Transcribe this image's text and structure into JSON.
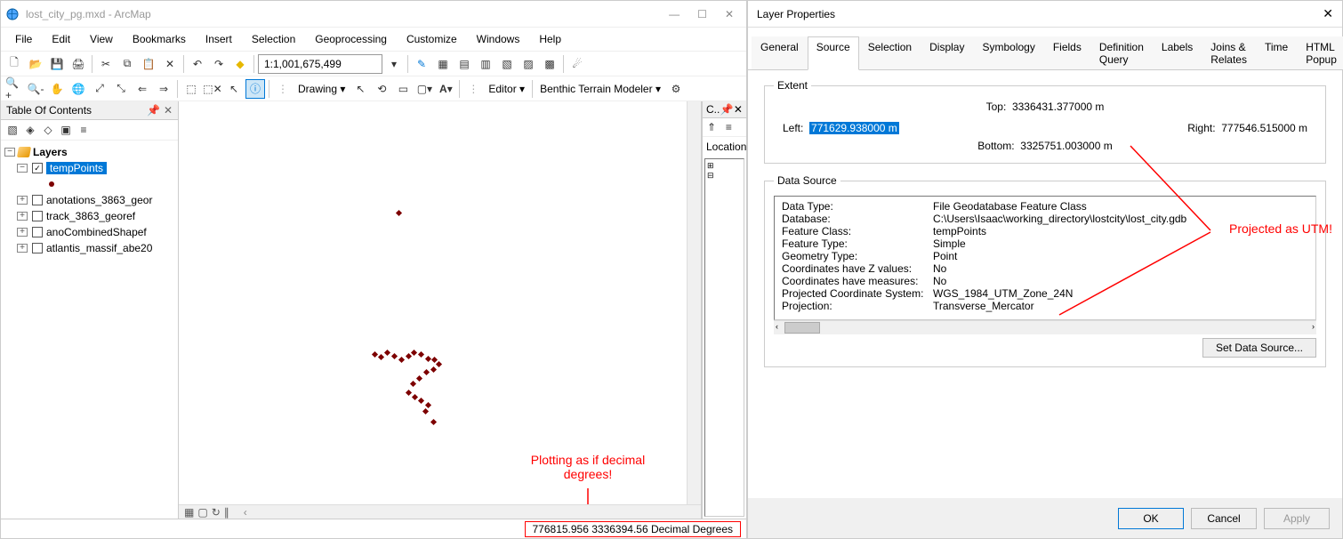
{
  "arcmap": {
    "title": "lost_city_pg.mxd - ArcMap",
    "window_controls": {
      "min": "—",
      "max": "☐",
      "close": "✕"
    },
    "menus": [
      "File",
      "Edit",
      "View",
      "Bookmarks",
      "Insert",
      "Selection",
      "Geoprocessing",
      "Customize",
      "Windows",
      "Help"
    ],
    "scale": "1:1,001,675,499",
    "drawing_label": "Drawing ▾",
    "editor_label": "Editor ▾",
    "btm_label": "Benthic Terrain Modeler ▾",
    "toc_title": "Table Of Contents",
    "toc": {
      "root": "Layers",
      "items": [
        {
          "name": "tempPoints",
          "checked": true,
          "selected": true
        },
        {
          "name": "anotations_3863_geor",
          "checked": false,
          "selected": false
        },
        {
          "name": "track_3863_georef",
          "checked": false,
          "selected": false
        },
        {
          "name": "anoCombinedShapef",
          "checked": false,
          "selected": false
        },
        {
          "name": "atlantis_massif_abe20",
          "checked": false,
          "selected": false
        }
      ]
    },
    "catalog_tab": "C..",
    "location_label": "Location:",
    "status_coord": "776815.956  3336394.56 Decimal Degrees",
    "annotation1": "Plotting as if decimal degrees!"
  },
  "dialog": {
    "title": "Layer Properties",
    "close": "✕",
    "tabs": [
      "General",
      "Source",
      "Selection",
      "Display",
      "Symbology",
      "Fields",
      "Definition Query",
      "Labels",
      "Joins & Relates",
      "Time",
      "HTML Popup"
    ],
    "active_tab": "Source",
    "extent": {
      "legend": "Extent",
      "top_label": "Top:",
      "top_val": "3336431.377000 m",
      "left_label": "Left:",
      "left_val": "771629.938000 m",
      "right_label": "Right:",
      "right_val": "777546.515000 m",
      "bottom_label": "Bottom:",
      "bottom_val": "3325751.003000 m"
    },
    "data_source_legend": "Data Source",
    "data_source": [
      {
        "k": "Data Type:",
        "v": "File Geodatabase Feature Class"
      },
      {
        "k": "Database:",
        "v": "C:\\Users\\Isaac\\working_directory\\lostcity\\lost_city.gdb"
      },
      {
        "k": "Feature Class:",
        "v": "tempPoints"
      },
      {
        "k": "Feature Type:",
        "v": "Simple"
      },
      {
        "k": "Geometry Type:",
        "v": "Point"
      },
      {
        "k": "Coordinates have Z values:",
        "v": "No"
      },
      {
        "k": "Coordinates have measures:",
        "v": "No"
      },
      {
        "k": "",
        "v": ""
      },
      {
        "k": "Projected Coordinate System:",
        "v": "WGS_1984_UTM_Zone_24N"
      },
      {
        "k": "Projection:",
        "v": "Transverse_Mercator"
      }
    ],
    "set_ds_button": "Set Data Source...",
    "buttons": {
      "ok": "OK",
      "cancel": "Cancel",
      "apply": "Apply"
    },
    "annotation2": "Projected as UTM!"
  }
}
